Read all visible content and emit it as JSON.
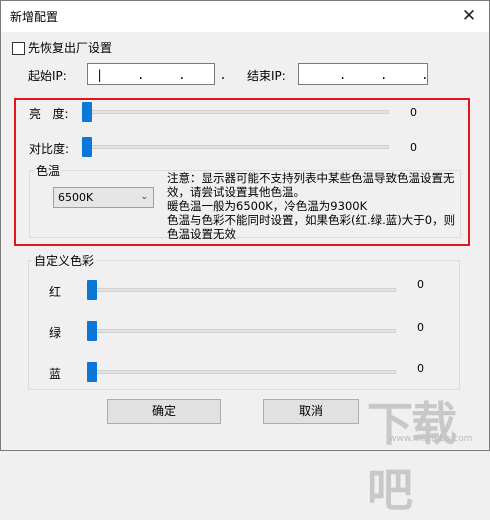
{
  "window": {
    "title": "新增配置",
    "close_glyph": "✕"
  },
  "restore_checkbox": {
    "label": "先恢复出厂设置",
    "checked": false
  },
  "start_ip": {
    "label": "起始IP:",
    "value": "|    .    .    ."
  },
  "end_ip": {
    "label": "结束IP:",
    "value": ".    .    ."
  },
  "brightness": {
    "label": "亮   度:",
    "value": "0",
    "level": 0
  },
  "contrast": {
    "label": "对比度:",
    "value": "0",
    "level": 0
  },
  "color_temp": {
    "label": "色温",
    "selected": "6500K",
    "note": "注意：显示器可能不支持列表中某些色温导致色温设置无效，请尝试设置其他色温。\n暖色温一般为6500K，冷色温为9300K\n色温与色彩不能同时设置，如果色彩(红.绿.蓝)大于0，则色温设置无效"
  },
  "custom_color": {
    "label": "自定义色彩",
    "red": {
      "label": "红",
      "value": "0",
      "level": 0
    },
    "green": {
      "label": "绿",
      "value": "0",
      "level": 0
    },
    "blue": {
      "label": "蓝",
      "value": "0",
      "level": 0
    }
  },
  "buttons": {
    "ok": "确定",
    "cancel": "取消"
  },
  "watermark": {
    "text": "下载吧",
    "url": "www.xiazaiba.com"
  },
  "colors": {
    "highlight": "#e0161b",
    "thumb": "#0b78d7"
  }
}
